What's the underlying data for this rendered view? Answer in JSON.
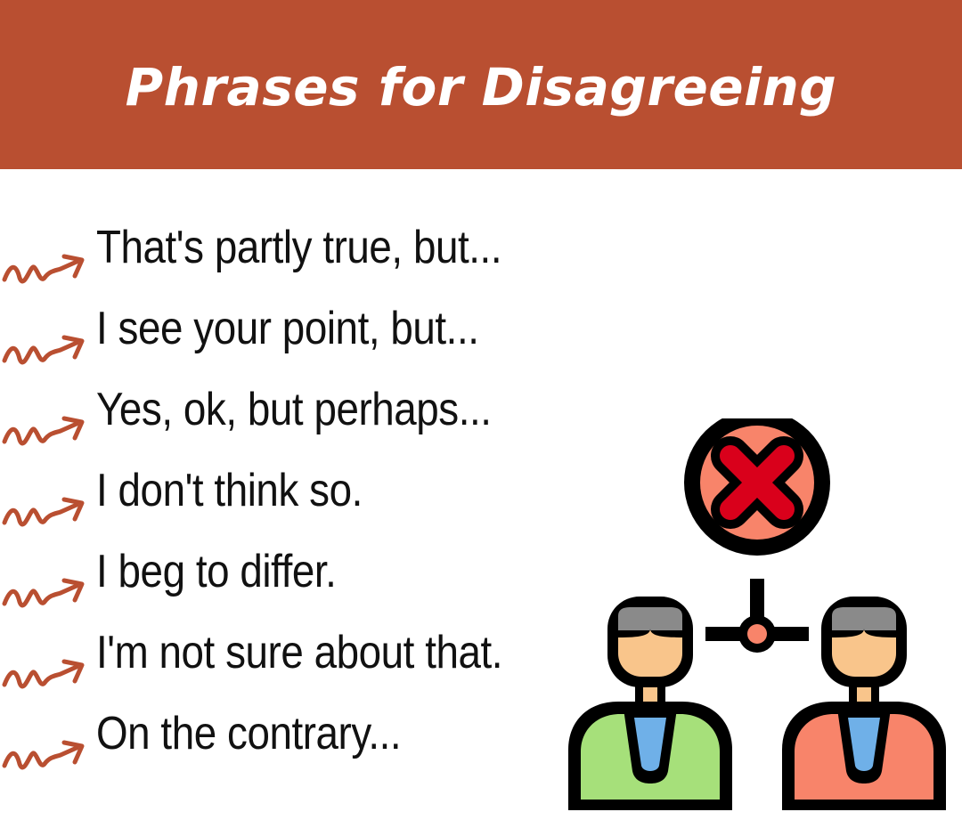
{
  "header": {
    "title": "Phrases for Disagreeing",
    "background": "#b94f31"
  },
  "phrases": [
    "That's partly true, but...",
    "I see your point, but...",
    "Yes, ok, but perhaps...",
    "I don't think so.",
    "I beg to differ.",
    "I'm not sure about that.",
    "On the contrary..."
  ],
  "colors": {
    "arrow": "#b94f31",
    "cross_circle": "#f8846a",
    "cross": "#d9001b",
    "person_left_shirt": "#a6e07a",
    "person_right_shirt": "#f8846a",
    "tie": "#6fb0e8",
    "skin": "#f9c58b",
    "hair": "#8a8a8a"
  },
  "icons": [
    "squiggle-arrow-icon",
    "disagreement-people-icon",
    "cross-icon"
  ]
}
